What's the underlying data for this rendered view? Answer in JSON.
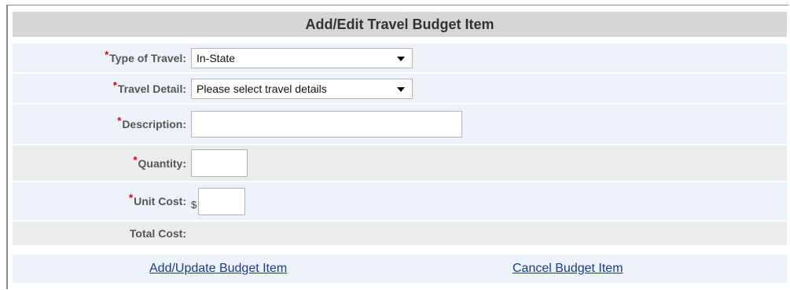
{
  "form": {
    "title": "Add/Edit Travel Budget Item",
    "required_marker": "*",
    "type_of_travel": {
      "label": "Type of Travel:",
      "value": "In-State"
    },
    "travel_detail": {
      "label": "Travel Detail:",
      "value": "Please select travel details"
    },
    "description": {
      "label": "Description:",
      "value": ""
    },
    "quantity": {
      "label": "Quantity:",
      "value": ""
    },
    "unit_cost": {
      "label": "Unit Cost:",
      "currency": "$",
      "value": ""
    },
    "total_cost": {
      "label": "Total Cost:",
      "value": ""
    }
  },
  "actions": {
    "add_update": "Add/Update Budget Item",
    "cancel": "Cancel Budget Item"
  },
  "colors": {
    "header_bg": "#d6d6d6",
    "row_light": "#eef3fb",
    "row_grey": "#ececec",
    "required": "#d40000",
    "link": "#1a3a9a"
  }
}
